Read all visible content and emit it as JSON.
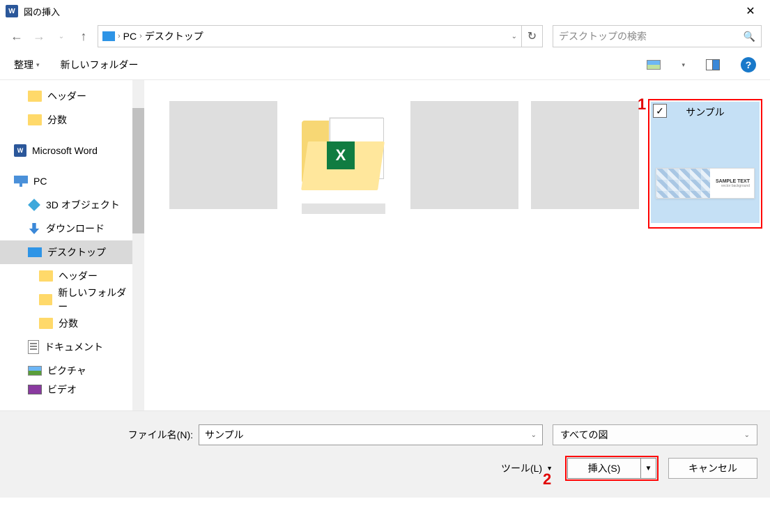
{
  "window": {
    "title": "図の挿入"
  },
  "breadcrumb": {
    "parts": [
      "PC",
      "デスクトップ"
    ]
  },
  "search": {
    "placeholder": "デスクトップの検索"
  },
  "toolbar": {
    "organize": "整理",
    "newFolder": "新しいフォルダー"
  },
  "sidebar": {
    "items": [
      {
        "label": "ヘッダー"
      },
      {
        "label": "分数"
      },
      {
        "label": "Microsoft Word"
      },
      {
        "label": "PC"
      },
      {
        "label": "3D オブジェクト"
      },
      {
        "label": "ダウンロード"
      },
      {
        "label": "デスクトップ"
      },
      {
        "label": "ヘッダー"
      },
      {
        "label": "新しいフォルダー"
      },
      {
        "label": "分数"
      },
      {
        "label": "ドキュメント"
      },
      {
        "label": "ピクチャ"
      },
      {
        "label": "ビデオ"
      }
    ]
  },
  "files": {
    "selected": {
      "label": "サンプル",
      "sample_text": "SAMPLE TEXT",
      "sample_sub": "vector background"
    }
  },
  "bottom": {
    "filenameLabel": "ファイル名(N):",
    "filenameValue": "サンプル",
    "filterValue": "すべての図",
    "tools": "ツール(L)",
    "insert": "挿入(S)",
    "cancel": "キャンセル"
  },
  "annotations": {
    "n1": "1",
    "n2": "2"
  }
}
